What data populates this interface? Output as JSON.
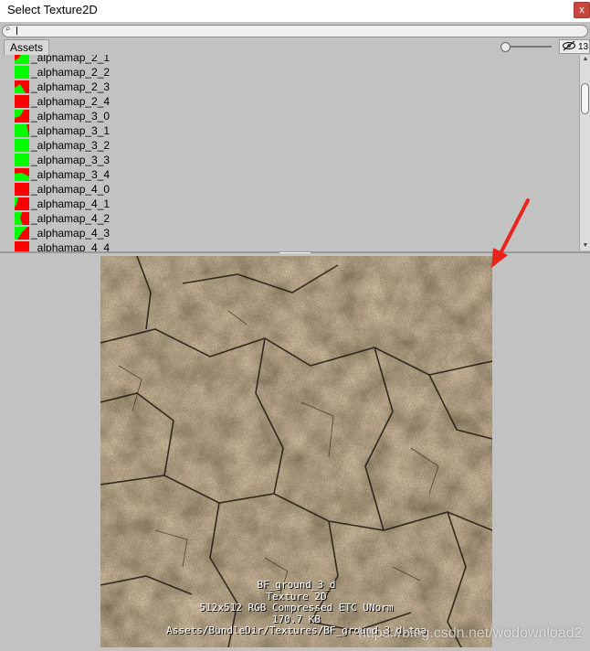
{
  "window": {
    "title": "Select Texture2D",
    "close_label": "x"
  },
  "search": {
    "icon": "search-icon",
    "value": ""
  },
  "toolbar": {
    "tab_label": "Assets",
    "hidden_count": "13"
  },
  "list": {
    "items": [
      {
        "label": "_alphamap_2_1",
        "thumb": "mixed-a"
      },
      {
        "label": "_alphamap_2_2",
        "thumb": "green"
      },
      {
        "label": "_alphamap_2_3",
        "thumb": "mixed-b"
      },
      {
        "label": "_alphamap_2_4",
        "thumb": "red"
      },
      {
        "label": "_alphamap_3_0",
        "thumb": "mixed-c"
      },
      {
        "label": "_alphamap_3_1",
        "thumb": "green-edge"
      },
      {
        "label": "_alphamap_3_2",
        "thumb": "green"
      },
      {
        "label": "_alphamap_3_3",
        "thumb": "green"
      },
      {
        "label": "_alphamap_3_4",
        "thumb": "mixed-d"
      },
      {
        "label": "_alphamap_4_0",
        "thumb": "red"
      },
      {
        "label": "_alphamap_4_1",
        "thumb": "mixed-e"
      },
      {
        "label": "_alphamap_4_2",
        "thumb": "mixed-f"
      },
      {
        "label": "_alphamap_4_3",
        "thumb": "mixed-g"
      },
      {
        "label": "_alphamap_4_4",
        "thumb": "red"
      }
    ]
  },
  "preview": {
    "name": "BF_ground_3_d",
    "type": "Texture 2D",
    "format": "512x512  RGB Compressed ETC UNorm",
    "size": "170.7 KB",
    "path": "Assets/BundleDir/Textures/BF_ground_3_d.tga"
  },
  "watermark": "https://blog.csdn.net/wodownload2",
  "colors": {
    "green": "#00ff00",
    "red": "#ff0000",
    "arrow": "#e8231b"
  }
}
